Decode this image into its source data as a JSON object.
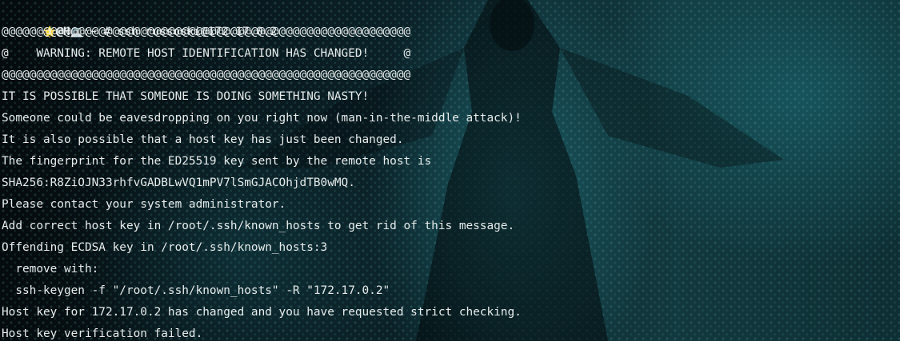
{
  "prompt": {
    "star_icon": "star-icon",
    "at_host": "@H",
    "laptop_icon": "laptop-icon",
    "path_and_cmd": ":~ # ssh russoski@172.17.0.2"
  },
  "output": [
    "@@@@@@@@@@@@@@@@@@@@@@@@@@@@@@@@@@@@@@@@@@@@@@@@@@@@@@@@@@@",
    "@    WARNING: REMOTE HOST IDENTIFICATION HAS CHANGED!     @",
    "@@@@@@@@@@@@@@@@@@@@@@@@@@@@@@@@@@@@@@@@@@@@@@@@@@@@@@@@@@@",
    "IT IS POSSIBLE THAT SOMEONE IS DOING SOMETHING NASTY!",
    "Someone could be eavesdropping on you right now (man-in-the-middle attack)!",
    "It is also possible that a host key has just been changed.",
    "The fingerprint for the ED25519 key sent by the remote host is",
    "SHA256:R8ZiOJN33rhfvGADBLwVQ1mPV7lSmGJACOhjdTB0wMQ.",
    "Please contact your system administrator.",
    "Add correct host key in /root/.ssh/known_hosts to get rid of this message.",
    "Offending ECDSA key in /root/.ssh/known_hosts:3",
    "  remove with:",
    "  ssh-keygen -f \"/root/.ssh/known_hosts\" -R \"172.17.0.2\"",
    "Host key for 172.17.0.2 has changed and you have requested strict checking.",
    "Host key verification failed."
  ],
  "colors": {
    "text": "#e6ecec",
    "background": "#0b2228",
    "accent": "#2a8a92"
  }
}
